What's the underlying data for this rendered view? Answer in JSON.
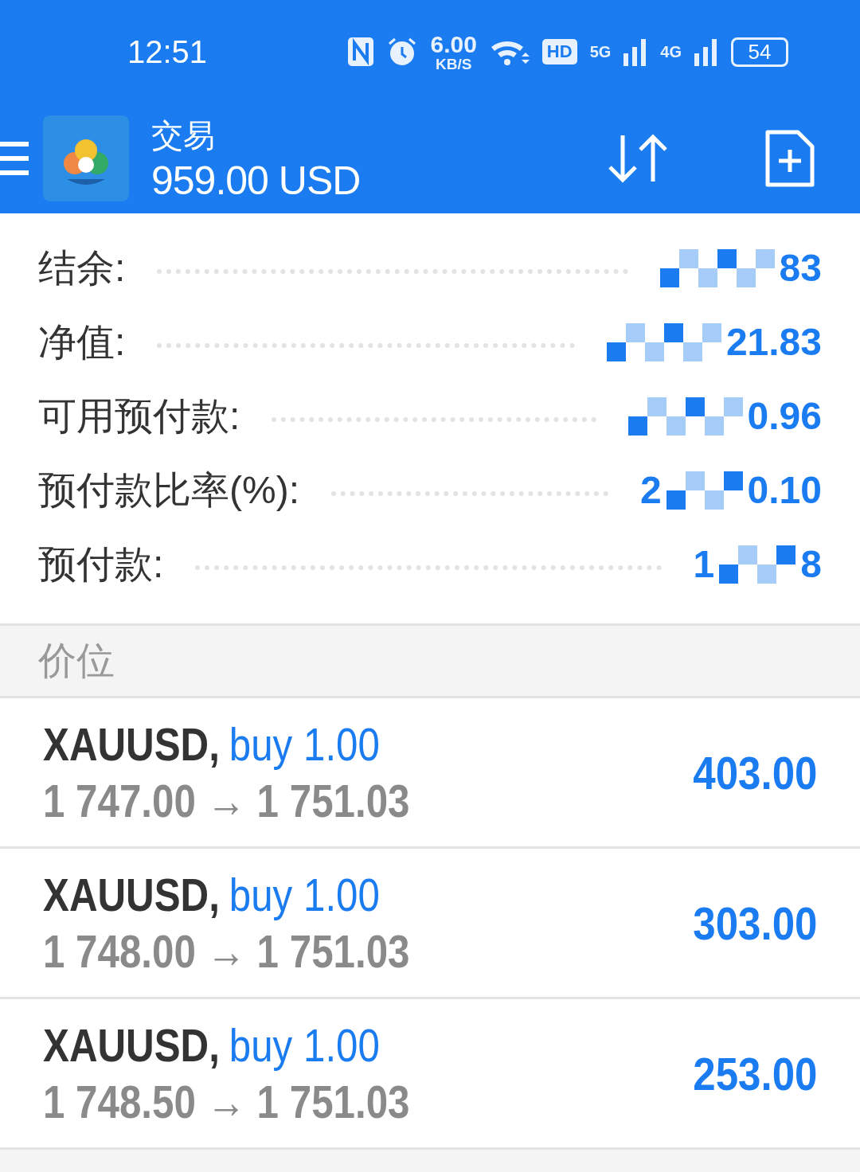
{
  "status_bar": {
    "time": "12:51",
    "speed_value": "6.00",
    "speed_unit": "KB/S",
    "hd_label": "HD",
    "sim_5g": "5G",
    "sim_4g": "4G",
    "battery": "54"
  },
  "header": {
    "title": "交易",
    "balance": "959.00 USD"
  },
  "account": [
    {
      "label": "结余:",
      "visible_end": "83",
      "masked": true
    },
    {
      "label": "净值:",
      "visible_end": "21.83",
      "masked": true
    },
    {
      "label": "可用预付款:",
      "visible_end": "0.96",
      "masked": true
    },
    {
      "label": "预付款比率(%):",
      "visible_start": "2",
      "visible_end": "0.10",
      "masked": true
    },
    {
      "label": "预付款:",
      "visible_start": "1",
      "visible_end": "8",
      "masked": true
    }
  ],
  "section": {
    "title": "价位"
  },
  "positions": [
    {
      "symbol": "XAUUSD,",
      "side": "buy 1.00",
      "prices": "1 747.00 → 1 751.03",
      "profit": "403.00"
    },
    {
      "symbol": "XAUUSD,",
      "side": "buy 1.00",
      "prices": "1 748.00 → 1 751.03",
      "profit": "303.00"
    },
    {
      "symbol": "XAUUSD,",
      "side": "buy 1.00",
      "prices": "1 748.50 → 1 751.03",
      "profit": "253.00"
    }
  ]
}
